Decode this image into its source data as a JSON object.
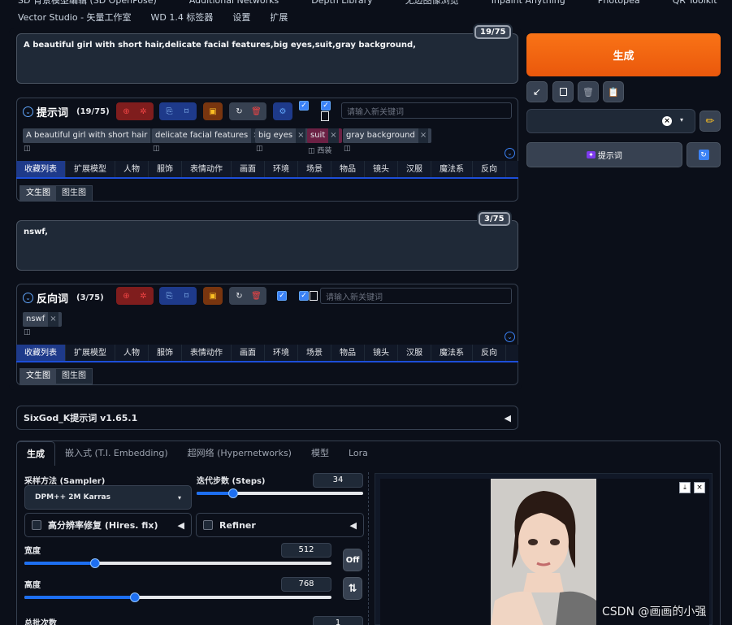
{
  "nav": {
    "row1": [
      "SD 背景模型编辑 (SD OpenPose)",
      "Additional Networks",
      "Depth Library",
      "无边图像浏览",
      "Inpaint Anything",
      "Photopea",
      "QR Toolkit"
    ],
    "row2": [
      "Vector Studio - 矢量工作室",
      "WD 1.4 标签器",
      "设置",
      "扩展"
    ]
  },
  "prompt": {
    "text": "A beautiful girl with short hair,delicate facial features,big eyes,suit,gray background,",
    "counter": "19/75",
    "section_title": "提示词",
    "section_count": "(19/75)",
    "keyword_placeholder": "请输入新关键词",
    "tags": [
      {
        "label": "A beautiful girl with short hair",
        "sub": "◫"
      },
      {
        "label": "delicate facial features",
        "sub": "◫"
      },
      {
        "label": "big eyes",
        "sub": "◫"
      },
      {
        "label": "suit",
        "sub": "◫ 西装"
      },
      {
        "label": "gray background",
        "sub": "◫"
      }
    ]
  },
  "negative": {
    "text": "nswf,",
    "counter": "3/75",
    "section_title": "反向词",
    "section_count": "(3/75)",
    "keyword_placeholder": "请输入新关键词",
    "tags": [
      {
        "label": "nswf",
        "sub": "◫"
      }
    ]
  },
  "categories": [
    "收藏列表",
    "扩展模型",
    "人物",
    "服饰",
    "表情动作",
    "画面",
    "环境",
    "场景",
    "物品",
    "镜头",
    "汉服",
    "魔法系",
    "反向"
  ],
  "subtabs": [
    "文生图",
    "图生图"
  ],
  "sixgod": {
    "title": "SixGod_K提示词 v1.65.1",
    "arrow": "◀"
  },
  "right": {
    "generate": "生成",
    "prompt_btn": "提示词",
    "colors": {
      "generate": "#f97316"
    }
  },
  "main_tabs": [
    "生成",
    "嵌入式 (T.I. Embedding)",
    "超网络 (Hypernetworks)",
    "模型",
    "Lora"
  ],
  "settings": {
    "sampler_label": "采样方法 (Sampler)",
    "sampler_value": "DPM++ 2M Karras",
    "steps_label": "迭代步数 (Steps)",
    "steps_value": "34",
    "steps_fraction": 0.22,
    "hires_label": "高分辨率修复 (Hires. fix)",
    "refiner_label": "Refiner",
    "width_label": "宽度",
    "width_value": "512",
    "width_fraction": 0.23,
    "height_label": "高度",
    "height_value": "768",
    "height_fraction": 0.36,
    "batch_label": "总批次数",
    "batch_value": "1",
    "off_label": "Off",
    "swap_icon": "⇅"
  },
  "watermark": "CSDN @画画的小强"
}
